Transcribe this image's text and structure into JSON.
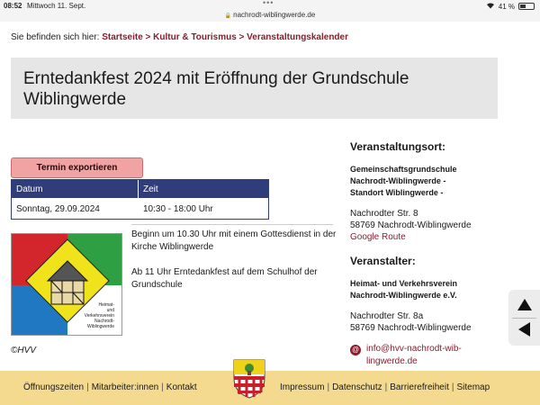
{
  "status_bar": {
    "time": "08:52",
    "date": "Mittwoch 11. Sept.",
    "url": "nachrodt-wiblingwerde.de",
    "battery": "41 %",
    "battery_level": 0.41
  },
  "breadcrumb": {
    "prefix": "Sie befinden sich hier:",
    "items": [
      "Startseite",
      "Kultur & Tourismus",
      "Veranstaltungskalender"
    ],
    "separator": ">"
  },
  "page": {
    "title": "Erntedankfest 2024 mit Eröffnung der Grundschule Wiblingwerde"
  },
  "event": {
    "export_label": "Termin exportieren",
    "table": {
      "headers": [
        "Datum",
        "Zeit"
      ],
      "rows": [
        [
          "Sonntag, 29.09.2024",
          "10:30 - 18:00 Uhr"
        ]
      ]
    },
    "description": [
      "Beginn um 10.30 Uhr mit einem Gottesdienst in der Kirche Wiblingwerde",
      "Ab 11 Uhr Erntedankfest auf dem Schulhof der Grundschule"
    ],
    "logo_caption": [
      "Heimat-",
      "und",
      "Verkehrsverein",
      "Nachrodt-",
      "Wiblingwerde"
    ],
    "copyright": "©HVV"
  },
  "venue": {
    "heading": "Veranstaltungsort:",
    "name_lines": [
      "Gemeinschaftsgrundschule",
      "Nachrodt-Wiblingwerde -",
      "Standort Wiblingwerde -"
    ],
    "street": "Nachrodter Str. 8",
    "city": "58769 Nachrodt-Wiblingwerde",
    "route_label": "Google Route"
  },
  "organizer": {
    "heading": "Veranstalter:",
    "name_lines": [
      "Heimat- und Verkehrsverein",
      "Nachrodt-Wiblingwerde e.V."
    ],
    "street": "Nachrodter Str. 8a",
    "city": "58769 Nachrodt-Wiblingwerde",
    "email_lines": [
      "info@hvv-nachrodt-wib-",
      "lingwerde.de"
    ]
  },
  "footer": {
    "left": [
      "Öffnungszeiten",
      "Mitarbeiter:innen",
      "Kontakt"
    ],
    "right": [
      "Impressum",
      "Datenschutz",
      "Barrierefreiheit",
      "Sitemap"
    ]
  },
  "colors": {
    "accent": "#8a1c2b",
    "table_header": "#2f3d7a",
    "export_button": "#f1a3a3",
    "title_box": "#e6e6e6",
    "footer": "#f3da8e"
  },
  "icons": [
    "lock-icon",
    "wifi-icon",
    "battery-icon",
    "email-icon",
    "scroll-up-icon",
    "back-arrow-icon",
    "crest-icon"
  ]
}
